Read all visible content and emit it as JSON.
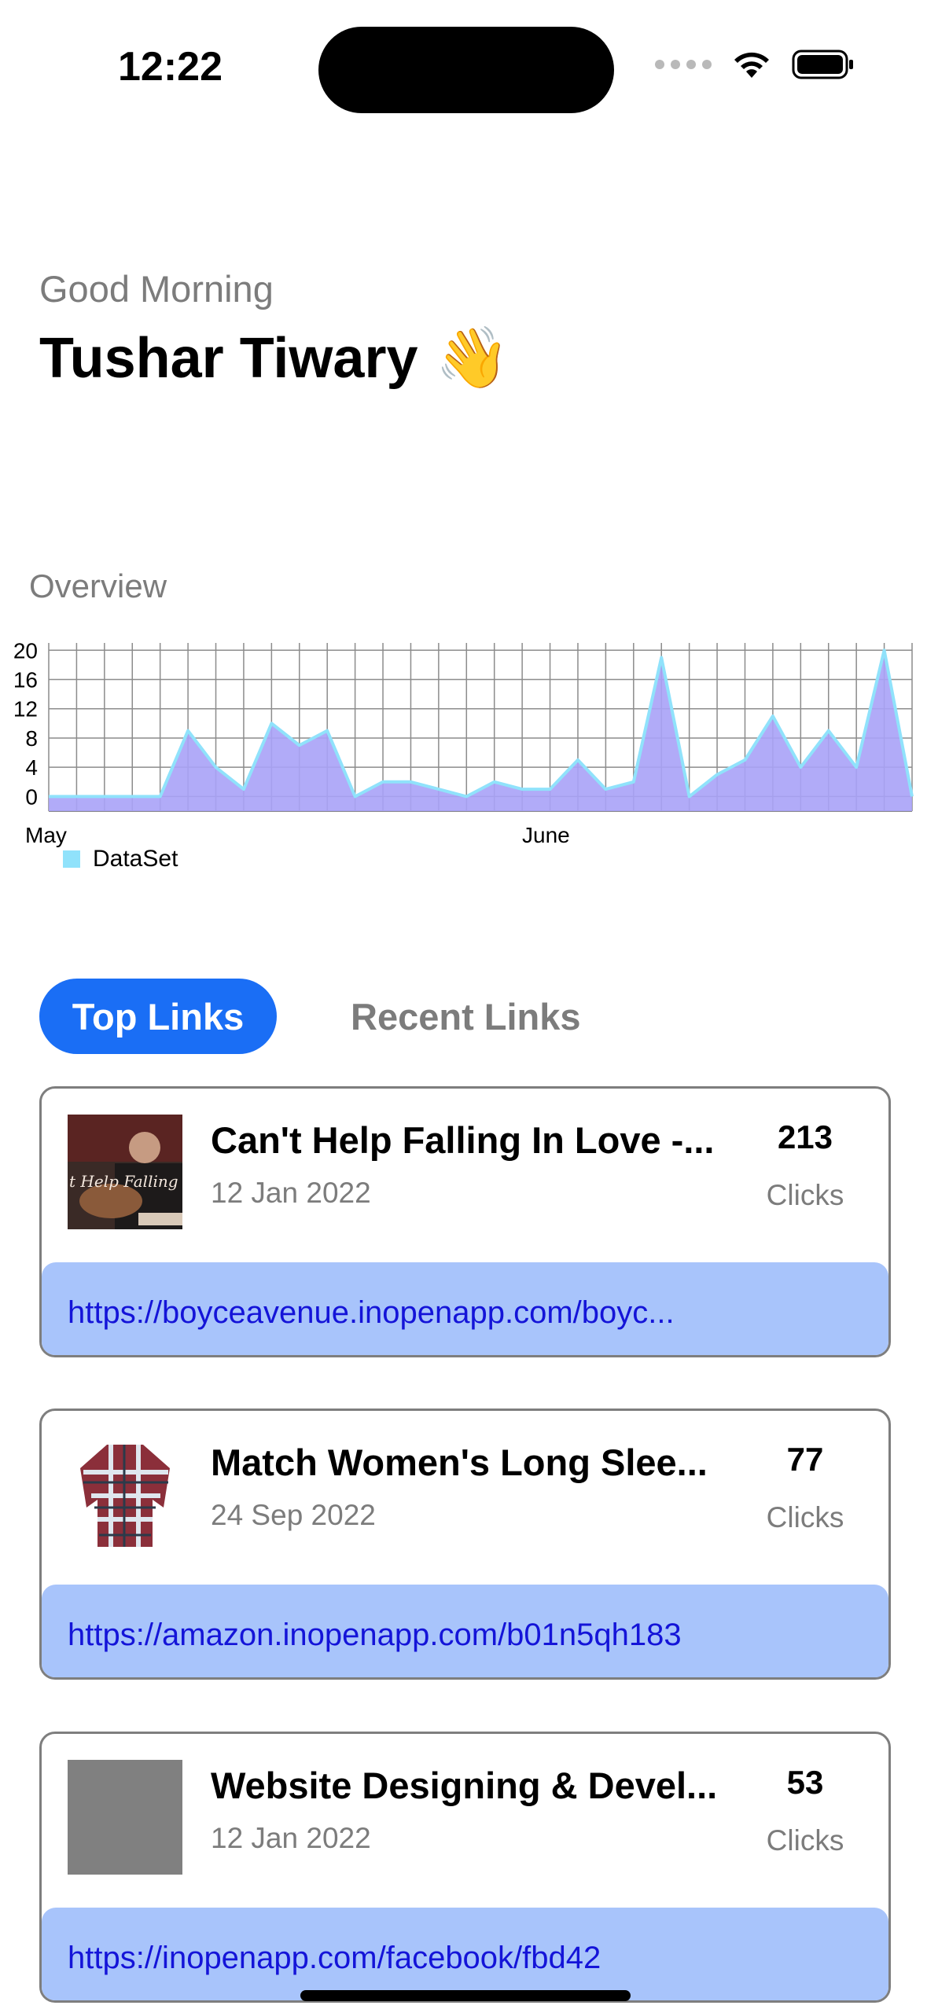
{
  "status_bar": {
    "time": "12:22"
  },
  "greeting": {
    "salutation": "Good Morning",
    "name": "Tushar Tiwary",
    "emoji": "👋"
  },
  "overview": {
    "label": "Overview"
  },
  "chart_data": {
    "type": "area",
    "title": "",
    "series": [
      {
        "name": "DataSet",
        "values": [
          0,
          0,
          0,
          0,
          0,
          9,
          4,
          1,
          10,
          7,
          9,
          0,
          2,
          2,
          1,
          0,
          2,
          1,
          1,
          5,
          1,
          2,
          19,
          0,
          3,
          5,
          11,
          4,
          9,
          4,
          20,
          0
        ]
      }
    ],
    "x_tick_labels": [
      "May",
      "June"
    ],
    "y_ticks": [
      0,
      4,
      8,
      12,
      16,
      20
    ],
    "ylim": [
      -2,
      21
    ],
    "grid": true,
    "legend": "bottom-left",
    "fill_color": "#a9a2f7",
    "line_color": "#90e2fb"
  },
  "tabs": [
    {
      "label": "Top Links",
      "active": true
    },
    {
      "label": "Recent Links",
      "active": false
    }
  ],
  "links": [
    {
      "title": "Can't Help Falling In Love -...",
      "date": "12 Jan 2022",
      "clicks": "213",
      "clicks_label": "Clicks",
      "url": "https://boyceavenue.inopenapp.com/boyc...",
      "thumb": "music-video-photo"
    },
    {
      "title": "Match Women's Long Slee...",
      "date": "24 Sep 2022",
      "clicks": "77",
      "clicks_label": "Clicks",
      "url": "https://amazon.inopenapp.com/b01n5qh183",
      "thumb": "plaid-shirt-photo"
    },
    {
      "title": "Website Designing & Devel...",
      "date": "12 Jan 2022",
      "clicks": "53",
      "clicks_label": "Clicks",
      "url": "https://inopenapp.com/facebook/fbd42",
      "thumb": "placeholder-image"
    }
  ],
  "colors": {
    "accent": "#1a6ef5",
    "link_bar": "#a8c4fb",
    "link_text": "#1414d8"
  }
}
